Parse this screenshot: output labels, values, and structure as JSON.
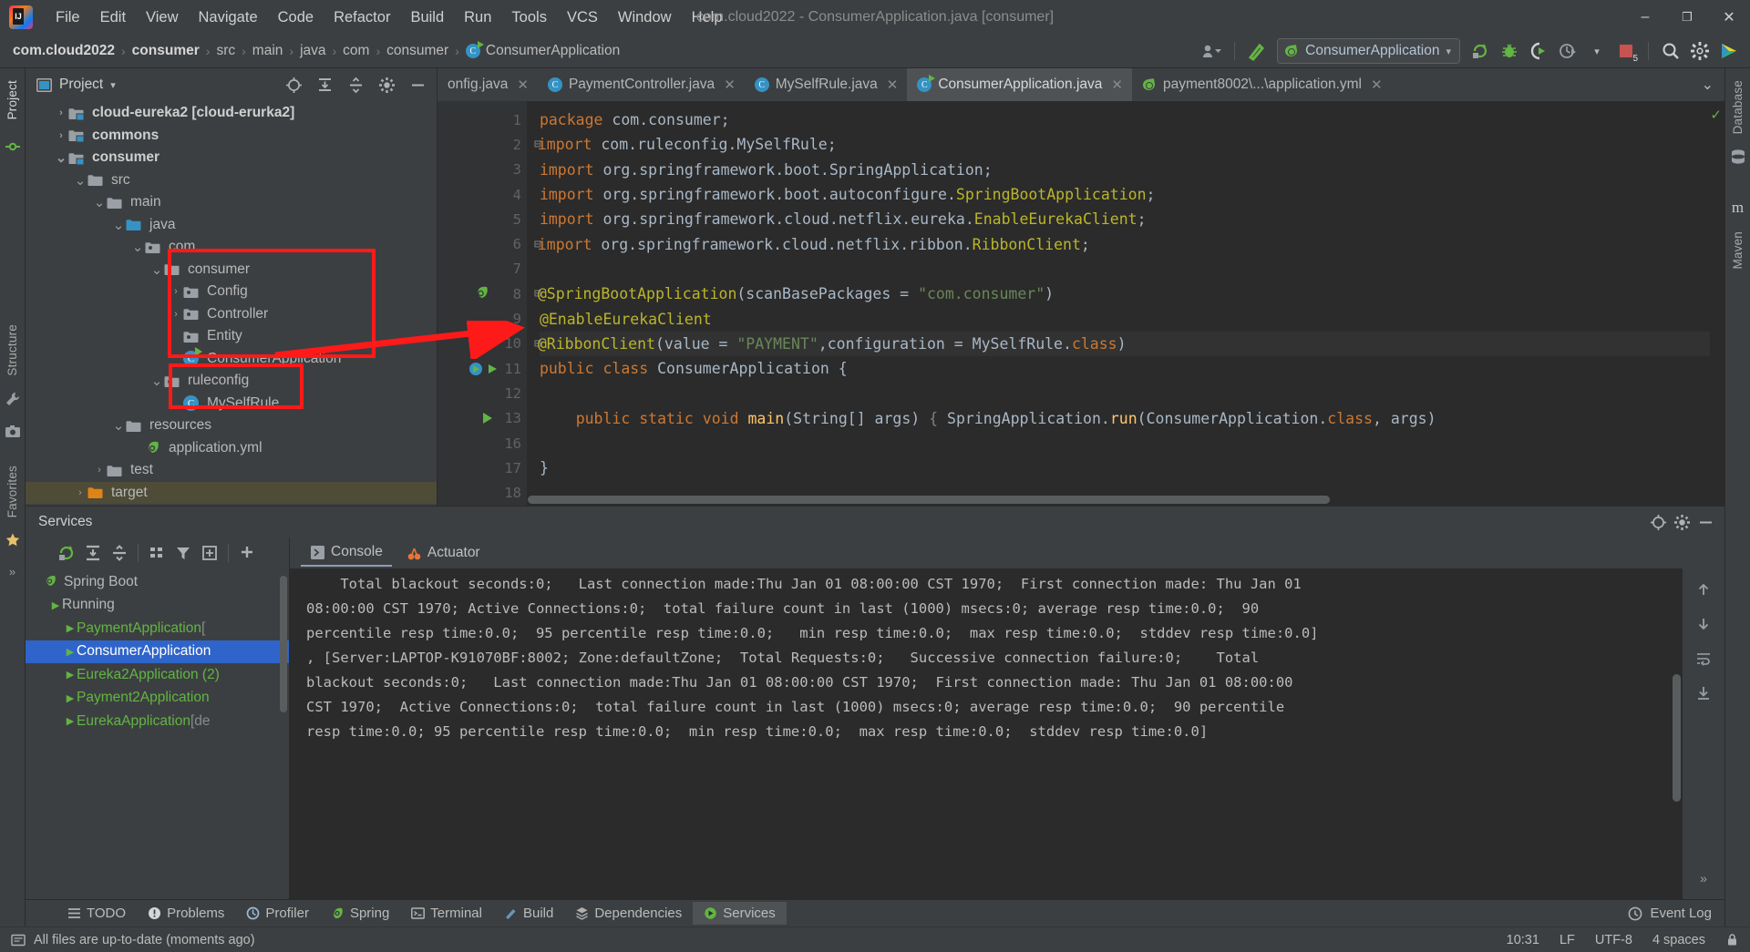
{
  "window": {
    "title": "com.cloud2022 - ConsumerApplication.java [consumer]",
    "minimize": "–",
    "maximize": "❐",
    "close": "✕"
  },
  "menubar": {
    "items": [
      "File",
      "Edit",
      "View",
      "Navigate",
      "Code",
      "Refactor",
      "Build",
      "Run",
      "Tools",
      "VCS",
      "Window",
      "Help"
    ]
  },
  "breadcrumb": {
    "items": [
      "com.cloud2022",
      "consumer",
      "src",
      "main",
      "java",
      "com",
      "consumer",
      "ConsumerApplication"
    ],
    "separator": "›"
  },
  "toolbar": {
    "run_config": "ConsumerApplication",
    "dropdown_caret": "▾",
    "icons": [
      "user-avatar-icon",
      "build-hammer-icon",
      "run-icon",
      "debug-icon",
      "run-coverage-icon",
      "profiler-icon",
      "stop-icon",
      "search-icon",
      "settings-gear-icon",
      "updates-icon"
    ],
    "stop_badge": "5"
  },
  "left_strip": {
    "tabs": [
      "Project",
      "Structure",
      "Favorites"
    ],
    "icons": [
      "commit-icon",
      "build-wrench-icon",
      "screenshot-icon",
      "bookmark-star-icon",
      "more-icon"
    ]
  },
  "right_strip": {
    "tabs": [
      "Database",
      "Maven"
    ],
    "icons": [
      "database-icon"
    ]
  },
  "project_pane": {
    "title": "Project",
    "caret": "▾",
    "actions": [
      "locate-icon",
      "expand-all-icon",
      "collapse-all-icon",
      "settings-gear-icon",
      "hide-icon"
    ],
    "tree": [
      {
        "label": "cloud-eureka2 [cloud-erurka2]",
        "indent": 1,
        "arrow": "›",
        "icon": "module-folder-icon",
        "bold": true,
        "selected": false
      },
      {
        "label": "commons",
        "indent": 1,
        "arrow": "›",
        "icon": "module-folder-icon",
        "bold": true,
        "selected": false
      },
      {
        "label": "consumer",
        "indent": 1,
        "arrow": "⌄",
        "icon": "module-folder-icon",
        "bold": true,
        "selected": false
      },
      {
        "label": "src",
        "indent": 2,
        "arrow": "⌄",
        "icon": "folder-icon",
        "bold": false,
        "selected": false
      },
      {
        "label": "main",
        "indent": 3,
        "arrow": "⌄",
        "icon": "folder-icon",
        "bold": false,
        "selected": false
      },
      {
        "label": "java",
        "indent": 4,
        "arrow": "⌄",
        "icon": "source-folder-icon",
        "bold": false,
        "selected": false
      },
      {
        "label": "com",
        "indent": 5,
        "arrow": "⌄",
        "icon": "package-icon",
        "bold": false,
        "selected": false
      },
      {
        "label": "consumer",
        "indent": 6,
        "arrow": "⌄",
        "icon": "package-icon",
        "bold": false,
        "selected": false
      },
      {
        "label": "Config",
        "indent": 7,
        "arrow": "›",
        "icon": "package-icon",
        "bold": false,
        "selected": false
      },
      {
        "label": "Controller",
        "indent": 7,
        "arrow": "›",
        "icon": "package-icon",
        "bold": false,
        "selected": false
      },
      {
        "label": "Entity",
        "indent": 7,
        "arrow": "",
        "icon": "package-icon",
        "bold": false,
        "selected": false
      },
      {
        "label": "ConsumerApplication",
        "indent": 7,
        "arrow": "",
        "icon": "java-class-runnable-icon",
        "bold": false,
        "selected": false
      },
      {
        "label": "ruleconfig",
        "indent": 6,
        "arrow": "⌄",
        "icon": "package-icon",
        "bold": false,
        "selected": false
      },
      {
        "label": "MySelfRule",
        "indent": 7,
        "arrow": "",
        "icon": "java-class-icon",
        "bold": false,
        "selected": false
      },
      {
        "label": "resources",
        "indent": 4,
        "arrow": "⌄",
        "icon": "resources-folder-icon",
        "bold": false,
        "selected": false
      },
      {
        "label": "application.yml",
        "indent": 5,
        "arrow": "",
        "icon": "spring-yaml-icon",
        "bold": false,
        "selected": false
      },
      {
        "label": "test",
        "indent": 3,
        "arrow": "›",
        "icon": "test-folder-icon",
        "bold": false,
        "selected": false
      },
      {
        "label": "target",
        "indent": 2,
        "arrow": "›",
        "icon": "target-folder-icon",
        "bold": false,
        "selected": true
      }
    ]
  },
  "editor": {
    "tabs": [
      {
        "label": "onfig.java",
        "icon": "java-class-icon",
        "active": false,
        "truncated": true
      },
      {
        "label": "PaymentController.java",
        "icon": "java-class-icon",
        "active": false
      },
      {
        "label": "MySelfRule.java",
        "icon": "java-class-icon",
        "active": false
      },
      {
        "label": "ConsumerApplication.java",
        "icon": "java-class-runnable-icon",
        "active": true
      },
      {
        "label": "payment8002\\...\\application.yml",
        "icon": "spring-yaml-icon",
        "active": false
      }
    ],
    "tab_close": "✕",
    "tab_list_caret": "⌄",
    "inspection_status": "✓",
    "line_numbers": [
      "1",
      "2",
      "3",
      "4",
      "5",
      "6",
      "7",
      "8",
      "9",
      "10",
      "11",
      "12",
      "13",
      "16",
      "17",
      "18"
    ],
    "lines": [
      {
        "n": "1",
        "segments": [
          {
            "t": "package",
            "c": "kw"
          },
          {
            "t": " com.consumer;",
            "c": "id"
          }
        ]
      },
      {
        "n": "2",
        "fold": true,
        "segments": [
          {
            "t": "import",
            "c": "kw"
          },
          {
            "t": " com.ruleconfig.MySelfRule;",
            "c": "id"
          }
        ]
      },
      {
        "n": "3",
        "segments": [
          {
            "t": "import",
            "c": "kw"
          },
          {
            "t": " org.springframework.boot.SpringApplication;",
            "c": "id"
          }
        ]
      },
      {
        "n": "4",
        "segments": [
          {
            "t": "import",
            "c": "kw"
          },
          {
            "t": " org.springframework.boot.autoconfigure.",
            "c": "id"
          },
          {
            "t": "SpringBootApplication",
            "c": "ann"
          },
          {
            "t": ";",
            "c": "id"
          }
        ]
      },
      {
        "n": "5",
        "segments": [
          {
            "t": "import",
            "c": "kw"
          },
          {
            "t": " org.springframework.cloud.netflix.eureka.",
            "c": "id"
          },
          {
            "t": "EnableEurekaClient",
            "c": "ann"
          },
          {
            "t": ";",
            "c": "id"
          }
        ]
      },
      {
        "n": "6",
        "fold": true,
        "segments": [
          {
            "t": "import",
            "c": "kw"
          },
          {
            "t": " org.springframework.cloud.netflix.ribbon.",
            "c": "id"
          },
          {
            "t": "RibbonClient",
            "c": "ann"
          },
          {
            "t": ";",
            "c": "id"
          }
        ]
      },
      {
        "n": "7",
        "segments": []
      },
      {
        "n": "8",
        "gutter_icon": "spring-bean-icon",
        "fold": true,
        "segments": [
          {
            "t": "@SpringBootApplication",
            "c": "ann"
          },
          {
            "t": "(scanBasePackages = ",
            "c": "id"
          },
          {
            "t": "\"com.consumer\"",
            "c": "str"
          },
          {
            "t": ")",
            "c": "id"
          }
        ]
      },
      {
        "n": "9",
        "segments": [
          {
            "t": "@EnableEurekaClient",
            "c": "ann"
          }
        ]
      },
      {
        "n": "10",
        "current": true,
        "fold": true,
        "segments": [
          {
            "t": "@RibbonClient",
            "c": "ann"
          },
          {
            "t": "(value = ",
            "c": "id"
          },
          {
            "t": "\"PAYMENT\"",
            "c": "str"
          },
          {
            "t": ",configuration = MySelfRule.",
            "c": "id"
          },
          {
            "t": "class",
            "c": "kw"
          },
          {
            "t": ")",
            "c": "id"
          }
        ]
      },
      {
        "n": "11",
        "gutter_icon": "run-gutter-icon",
        "segments": [
          {
            "t": "public",
            "c": "kw"
          },
          {
            "t": " ",
            "c": "id"
          },
          {
            "t": "class",
            "c": "kw"
          },
          {
            "t": " ConsumerApplication {",
            "c": "id"
          }
        ]
      },
      {
        "n": "12",
        "segments": []
      },
      {
        "n": "13",
        "gutter_icon": "run-method-icon",
        "segments": [
          {
            "t": "    ",
            "c": "id"
          },
          {
            "t": "public",
            "c": "kw"
          },
          {
            "t": " ",
            "c": "id"
          },
          {
            "t": "static",
            "c": "kw"
          },
          {
            "t": " ",
            "c": "id"
          },
          {
            "t": "void",
            "c": "kw"
          },
          {
            "t": " ",
            "c": "id"
          },
          {
            "t": "main",
            "c": "fn"
          },
          {
            "t": "(String[] args) ",
            "c": "id"
          },
          {
            "t": "{",
            "c": "cm"
          },
          {
            "t": " SpringApplication.",
            "c": "id"
          },
          {
            "t": "run",
            "c": "fn"
          },
          {
            "t": "(ConsumerApplication.",
            "c": "id"
          },
          {
            "t": "class",
            "c": "kw"
          },
          {
            "t": ", args)",
            "c": "id"
          }
        ]
      },
      {
        "n": "16",
        "segments": []
      },
      {
        "n": "17",
        "segments": [
          {
            "t": "}",
            "c": "id"
          }
        ]
      },
      {
        "n": "18",
        "segments": []
      }
    ]
  },
  "services": {
    "title": "Services",
    "header_actions": [
      "locate-icon",
      "settings-gear-icon",
      "hide-icon"
    ],
    "toolbar_icons": [
      "rerun-icon",
      "expand-all-icon",
      "collapse-all-icon",
      "group-icon",
      "filter-icon",
      "add-tab-icon",
      "add-service-icon"
    ],
    "tree": [
      {
        "label": "Spring Boot",
        "type": "root",
        "selected": false,
        "icon": "spring-icon"
      },
      {
        "label": "Running",
        "type": "group",
        "selected": false,
        "icon": "running-icon"
      },
      {
        "label": "PaymentApplication",
        "suffix": " [",
        "type": "service",
        "selected": false
      },
      {
        "label": "ConsumerApplication",
        "suffix": "",
        "type": "service",
        "selected": true
      },
      {
        "label": "Eureka2Application (2)",
        "suffix": "",
        "type": "service",
        "selected": false
      },
      {
        "label": "Payment2Application",
        "suffix": "",
        "type": "service",
        "selected": false
      },
      {
        "label": "EurekaApplication",
        "suffix": " [de",
        "type": "service",
        "selected": false
      }
    ],
    "console_tabs": [
      {
        "label": "Console",
        "icon": "console-icon",
        "active": true
      },
      {
        "label": "Actuator",
        "icon": "actuator-icon",
        "active": false
      }
    ],
    "console_text": "    Total blackout seconds:0;   Last connection made:Thu Jan 01 08:00:00 CST 1970;  First connection made: Thu Jan 01\n08:00:00 CST 1970; Active Connections:0;  total failure count in last (1000) msecs:0; average resp time:0.0;  90\npercentile resp time:0.0;  95 percentile resp time:0.0;   min resp time:0.0;  max resp time:0.0;  stddev resp time:0.0]\n, [Server:LAPTOP-K91070BF:8002; Zone:defaultZone;  Total Requests:0;   Successive connection failure:0;    Total\nblackout seconds:0;   Last connection made:Thu Jan 01 08:00:00 CST 1970;  First connection made: Thu Jan 01 08:00:00\nCST 1970;  Active Connections:0;  total failure count in last (1000) msecs:0; average resp time:0.0;  90 percentile\nresp time:0.0; 95 percentile resp time:0.0;  min resp time:0.0;  max resp time:0.0;  stddev resp time:0.0]",
    "side_icons": [
      "scroll-up-icon",
      "scroll-down-icon",
      "soft-wrap-icon",
      "scroll-to-end-icon",
      "expand-icon"
    ]
  },
  "bottom_tabs": {
    "items": [
      {
        "label": "TODO",
        "icon": "todo-icon",
        "active": false
      },
      {
        "label": "Problems",
        "icon": "problems-icon",
        "active": false
      },
      {
        "label": "Profiler",
        "icon": "profiler-icon",
        "active": false
      },
      {
        "label": "Spring",
        "icon": "spring-icon",
        "active": false
      },
      {
        "label": "Terminal",
        "icon": "terminal-icon",
        "active": false
      },
      {
        "label": "Build",
        "icon": "build-icon",
        "active": false
      },
      {
        "label": "Dependencies",
        "icon": "dependencies-icon",
        "active": false
      },
      {
        "label": "Services",
        "icon": "services-icon",
        "active": true
      }
    ],
    "event_log": {
      "label": "Event Log",
      "icon": "event-log-icon"
    }
  },
  "statusbar": {
    "message": "All files are up-to-date (moments ago)",
    "time": "10:31",
    "line_separator": "LF",
    "encoding": "UTF-8",
    "indent": "4 spaces",
    "lock_icon": "lock-icon"
  },
  "colors": {
    "accent_blue": "#3592c4",
    "green": "#62b543",
    "orange": "#cc7832",
    "string_green": "#6a8759",
    "annotation_yellow": "#bbb529",
    "selection_blue": "#2f65ca",
    "annotation_red": "#ff1a1a"
  }
}
